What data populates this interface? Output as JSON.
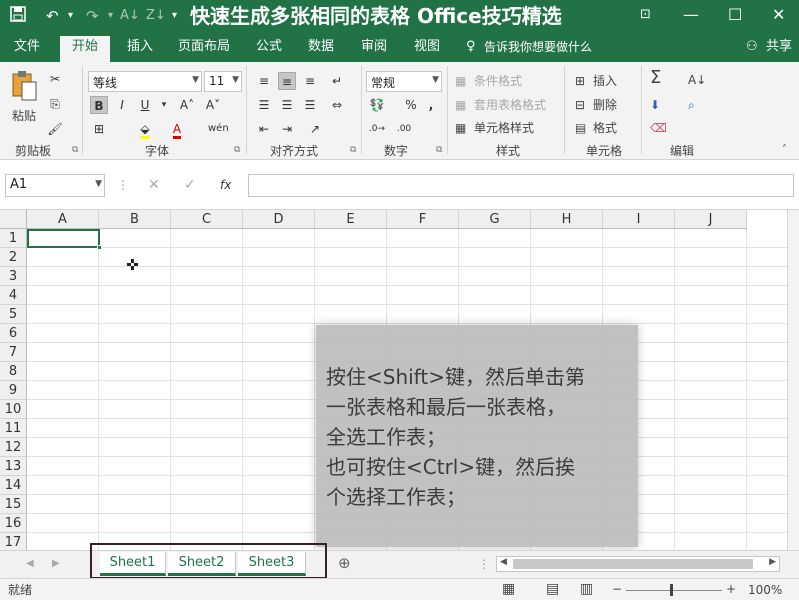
{
  "title_bar": {
    "title": "快速生成多张相同的表格 Office技巧精选",
    "save_icon": "save-icon",
    "undo_icon": "undo-icon",
    "redo_icon": "redo-icon",
    "accent": "#217346"
  },
  "menu_tabs": [
    {
      "label": "文件"
    },
    {
      "label": "开始",
      "active": true
    },
    {
      "label": "插入"
    },
    {
      "label": "页面布局"
    },
    {
      "label": "公式"
    },
    {
      "label": "数据"
    },
    {
      "label": "审阅"
    },
    {
      "label": "视图"
    }
  ],
  "tell_me": "告诉我你想要做什么",
  "share": "共享",
  "ribbon": {
    "clipboard": {
      "paste": "粘贴",
      "label": "剪贴板"
    },
    "font": {
      "name": "等线",
      "size": "11",
      "label": "字体",
      "bold": "B",
      "italic": "I",
      "underline": "U"
    },
    "alignment": {
      "label": "对齐方式"
    },
    "number": {
      "format": "常规",
      "label": "数字"
    },
    "styles": {
      "conditional": "条件格式",
      "table": "套用表格格式",
      "cell": "单元格样式",
      "label": "样式"
    },
    "cells": {
      "insert": "插入",
      "delete": "删除",
      "format": "格式",
      "label": "单元格"
    },
    "editing": {
      "label": "编辑"
    }
  },
  "formula_bar": {
    "name_box": "A1",
    "fx": "fx",
    "value": ""
  },
  "columns": [
    "A",
    "B",
    "C",
    "D",
    "E",
    "F",
    "G",
    "H",
    "I",
    "J"
  ],
  "rows": [
    "1",
    "2",
    "3",
    "4",
    "5",
    "6",
    "7",
    "8",
    "9",
    "10",
    "11",
    "12",
    "13",
    "14",
    "15",
    "16",
    "17"
  ],
  "selected_cell": "A1",
  "note": {
    "lines": [
      "按住<Shift>键，然后单击第",
      "一张表格和最后一张表格，",
      "全选工作表；",
      "也可按住<Ctrl>键，然后挨",
      "个选择工作表；"
    ]
  },
  "sheets": [
    {
      "name": "Sheet1",
      "active": true
    },
    {
      "name": "Sheet2"
    },
    {
      "name": "Sheet3"
    }
  ],
  "status": {
    "ready": "就绪",
    "zoom": "100%"
  }
}
